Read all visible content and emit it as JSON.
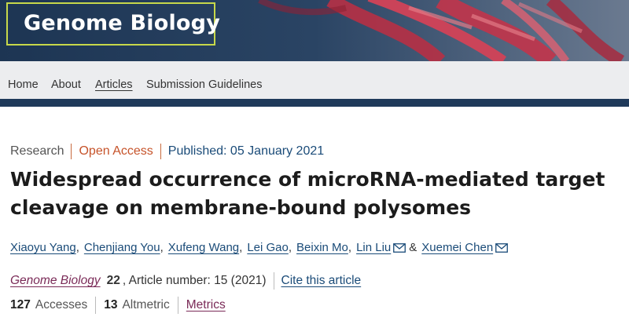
{
  "header": {
    "logo_text": "Genome Biology",
    "colors": {
      "banner": "#1f3a5a",
      "logo_border": "#c7d84a",
      "helix": "#c2344a"
    }
  },
  "nav": {
    "items": [
      {
        "label": "Home"
      },
      {
        "label": "About"
      },
      {
        "label": "Articles",
        "active": true
      },
      {
        "label": "Submission Guidelines"
      }
    ]
  },
  "article": {
    "type": "Research",
    "access": "Open Access",
    "published": "Published: 05 January 2021",
    "title": "Widespread occurrence of microRNA-mediated target cleavage on membrane-bound polysomes",
    "authors": [
      {
        "name": "Xiaoyu Yang",
        "sep": ","
      },
      {
        "name": "Chenjiang You",
        "sep": ","
      },
      {
        "name": "Xufeng Wang",
        "sep": ","
      },
      {
        "name": "Lei Gao",
        "sep": ","
      },
      {
        "name": "Beixin Mo",
        "sep": ","
      },
      {
        "name": "Lin Liu",
        "sep": "&",
        "mail": true
      },
      {
        "name": "Xuemei Chen",
        "sep": "",
        "mail": true
      }
    ],
    "journal": "Genome Biology",
    "volume": "22",
    "article_number": ", Article number: 15 (2021)",
    "cite_label": "Cite this article",
    "accesses_count": "127",
    "accesses_label": "Accesses",
    "altmetric_count": "13",
    "altmetric_label": "Altmetric",
    "metrics_label": "Metrics",
    "icons": {
      "mail": "mail-icon"
    }
  }
}
